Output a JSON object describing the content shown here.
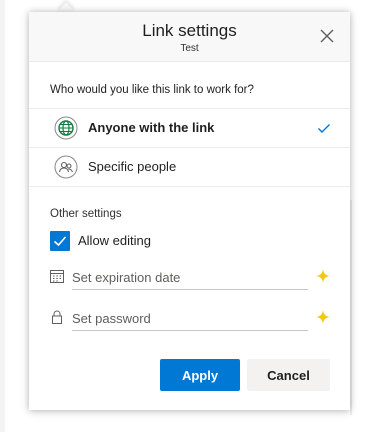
{
  "dialog": {
    "title": "Link settings",
    "subtitle": "Test",
    "close_icon": "close-icon"
  },
  "audience": {
    "question": "Who would you like this link to work for?",
    "options": [
      {
        "label": "Anyone with the link",
        "icon": "globe-icon",
        "selected": true
      },
      {
        "label": "Specific people",
        "icon": "people-icon",
        "selected": false
      }
    ]
  },
  "other_settings": {
    "label": "Other settings",
    "allow_editing": {
      "label": "Allow editing",
      "checked": true
    },
    "expiration": {
      "placeholder": "Set expiration date",
      "icon": "calendar-icon",
      "premium_icon": "sparkle-icon"
    },
    "password": {
      "placeholder": "Set password",
      "icon": "lock-icon",
      "premium_icon": "sparkle-icon"
    }
  },
  "actions": {
    "apply_label": "Apply",
    "cancel_label": "Cancel"
  },
  "colors": {
    "accent": "#0078d4",
    "premium": "#f2c811",
    "globe": "#107c41",
    "header_bg": "#f8f8f8"
  }
}
